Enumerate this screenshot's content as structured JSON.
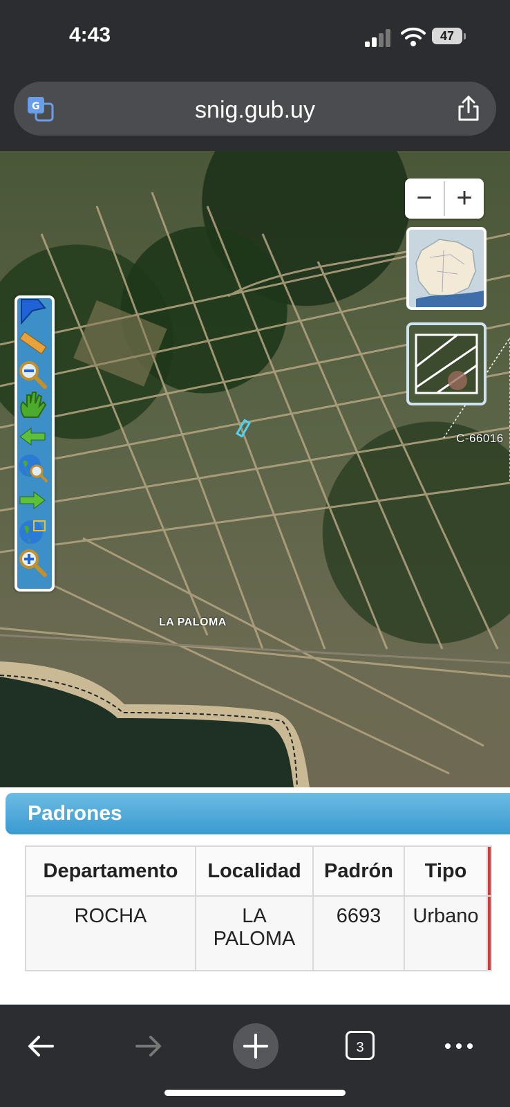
{
  "status_bar": {
    "time": "4:43",
    "battery": "47"
  },
  "browser": {
    "url": "snig.gub.uy",
    "tab_count": "3"
  },
  "map": {
    "place_label": "LA PALOMA",
    "parcel_label": "C-66016",
    "zoom_out_symbol": "−",
    "zoom_in_symbol": "+",
    "tools": [
      "flag-icon",
      "measure-ruler-icon",
      "zoom-out-magnifier-icon",
      "pan-hand-icon",
      "back-arrow-icon",
      "globe-search-icon",
      "forward-arrow-icon",
      "globe-extent-icon",
      "zoom-in-magnifier-icon"
    ]
  },
  "panel": {
    "title": "Padrones",
    "columns": [
      "Departamento",
      "Localidad",
      "Padrón",
      "Tipo"
    ],
    "rows": [
      {
        "departamento": "ROCHA",
        "localidad": "LA PALOMA",
        "padron": "6693",
        "tipo": "Urbano"
      }
    ]
  },
  "colors": {
    "panel_header": "#3a9ad0",
    "toolbar": "#3d8fc7",
    "chrome": "#2b2d30",
    "accent_red": "#d23b3b"
  }
}
